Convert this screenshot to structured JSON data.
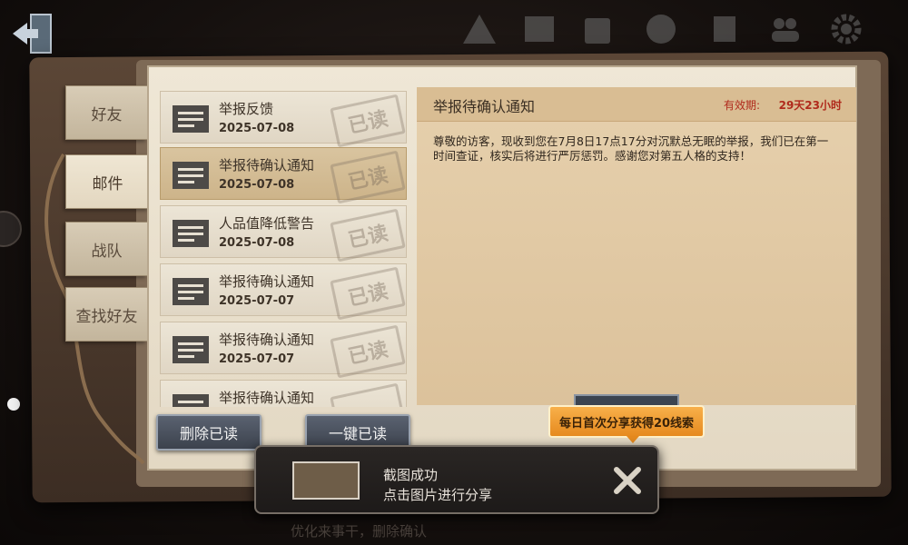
{
  "top_icons": [
    "warning-icon",
    "photo-icon",
    "shop-icon",
    "globe-icon",
    "trophy-icon",
    "friends-icon",
    "settings-icon"
  ],
  "tabs": [
    {
      "label": "好友",
      "active": false
    },
    {
      "label": "邮件",
      "active": true
    },
    {
      "label": "战队",
      "active": false
    },
    {
      "label": "查找好友",
      "active": false
    }
  ],
  "mail_list": [
    {
      "title": "举报反馈",
      "date": "2025-07-08",
      "stamp": "已读",
      "selected": false
    },
    {
      "title": "举报待确认通知",
      "date": "2025-07-08",
      "stamp": "已读",
      "selected": true
    },
    {
      "title": "人品值降低警告",
      "date": "2025-07-08",
      "stamp": "已读",
      "selected": false
    },
    {
      "title": "举报待确认通知",
      "date": "2025-07-07",
      "stamp": "已读",
      "selected": false
    },
    {
      "title": "举报待确认通知",
      "date": "2025-07-07",
      "stamp": "已读",
      "selected": false
    },
    {
      "title": "举报待确认通知",
      "date": "",
      "stamp": "",
      "selected": false
    }
  ],
  "detail": {
    "title": "举报待确认通知",
    "validity_label": "有效期:",
    "validity_value": "29天23小时",
    "body": "尊敬的访客，现收到您在7月8日17点17分对沉默总无眠的举报，我们已在第一时间查证，核实后将进行严厉惩罚。感谢您对第五人格的支持！"
  },
  "buttons": {
    "delete_read": "删除已读",
    "mark_all_read": "一键已读"
  },
  "share_hint": "每日首次分享获得20线索",
  "toast": {
    "line1": "截图成功",
    "line2": "点击图片进行分享"
  },
  "bottom_text": "优化来事干，删除确认"
}
